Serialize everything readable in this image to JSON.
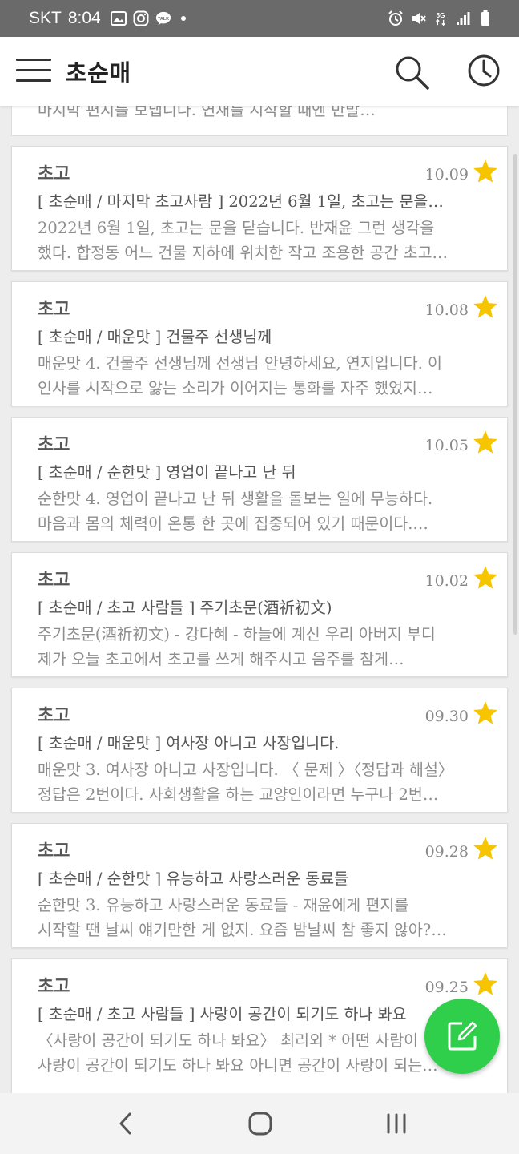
{
  "status_bar": {
    "carrier": "SKT",
    "time": "8:04",
    "left_icons": [
      "gallery-icon",
      "instagram-icon",
      "kakaotalk-icon"
    ],
    "right_icons": [
      "alarm-icon",
      "mute-icon",
      "5g-icon",
      "signal-icon",
      "battery-icon"
    ],
    "network_label": "5G"
  },
  "app_bar": {
    "title": "초순매",
    "icons": [
      "menu-icon",
      "search-icon",
      "history-icon"
    ]
  },
  "list": {
    "partial_item_text": "마지막 편지를 보냅니다. 연재를 시작할 때엔 만발…",
    "items": [
      {
        "category": "초고",
        "date": "10.09",
        "starred": true,
        "title": "[ 초순매 / 마지막 초고사람 ] 2022년 6월 1일, 초고는 문을…",
        "excerpt_line1": "2022년 6월 1일, 초고는 문을 닫습니다. 반재윤 그런 생각을",
        "excerpt_line2": "했다. 합정동 어느 건물 지하에 위치한 작고 조용한 공간 초고…"
      },
      {
        "category": "초고",
        "date": "10.08",
        "starred": true,
        "title": "[ 초순매 / 매운맛 ] 건물주 선생님께",
        "excerpt_line1": "매운맛 4. 건물주 선생님께 선생님 안녕하세요, 연지입니다. 이",
        "excerpt_line2": "인사를 시작으로 앓는 소리가 이어지는 통화를 자주 했었지…"
      },
      {
        "category": "초고",
        "date": "10.05",
        "starred": true,
        "title": "[ 초순매 / 순한맛 ] 영업이 끝나고 난 뒤",
        "excerpt_line1": "순한맛 4. 영업이 끝나고 난 뒤 생활을 돌보는 일에 무능하다.",
        "excerpt_line2": "마음과 몸의 체력이 온통 한 곳에 집중되어 있기 때문이다.…"
      },
      {
        "category": "초고",
        "date": "10.02",
        "starred": true,
        "title": "[ 초순매 / 초고 사람들 ] 주기초문(酒祈初文)",
        "excerpt_line1": "주기초문(酒祈初文) - 강다혜 - 하늘에 계신 우리 아버지 부디",
        "excerpt_line2": "제가 오늘 초고에서 초고를 쓰게 해주시고 음주를 참게…"
      },
      {
        "category": "초고",
        "date": "09.30",
        "starred": true,
        "title": "[ 초순매 / 매운맛 ] 여사장 아니고 사장입니다.",
        "excerpt_line1": "매운맛 3. 여사장 아니고 사장입니다. 〈 문제 〉〈정답과 해설〉",
        "excerpt_line2": "정답은 2번이다. 사회생활을 하는 교양인이라면 누구나 2번…"
      },
      {
        "category": "초고",
        "date": "09.28",
        "starred": true,
        "title": "[ 초순매 / 순한맛 ] 유능하고 사랑스러운 동료들",
        "excerpt_line1": "순한맛 3. 유능하고 사랑스러운 동료들 - 재윤에게 편지를",
        "excerpt_line2": "시작할 땐 날씨 얘기만한 게 없지. 요즘 밤날씨 참 좋지 않아?…"
      },
      {
        "category": "초고",
        "date": "09.25",
        "starred": true,
        "title": "[ 초순매 / 초고 사람들 ]  사랑이 공간이 되기도 하나 봐요",
        "excerpt_line1": "〈사랑이 공간이 되기도 하나 봐요〉 최리외 * 어떤 사람이",
        "excerpt_line2": "사랑이 공간이 되기도 하나 봐요 아니면 공간이 사랑이 되는…"
      }
    ]
  },
  "fab": {
    "icon": "compose-icon"
  },
  "nav_bar": {
    "icons": [
      "back-icon",
      "home-icon",
      "recents-icon"
    ]
  },
  "colors": {
    "status_bar_bg": "#6a6a6a",
    "app_bar_bg": "#ffffff",
    "list_bg": "#ededed",
    "star": "#f7c400",
    "fab": "#2fcf4c",
    "nav_bar_bg": "#f3f3f3"
  }
}
